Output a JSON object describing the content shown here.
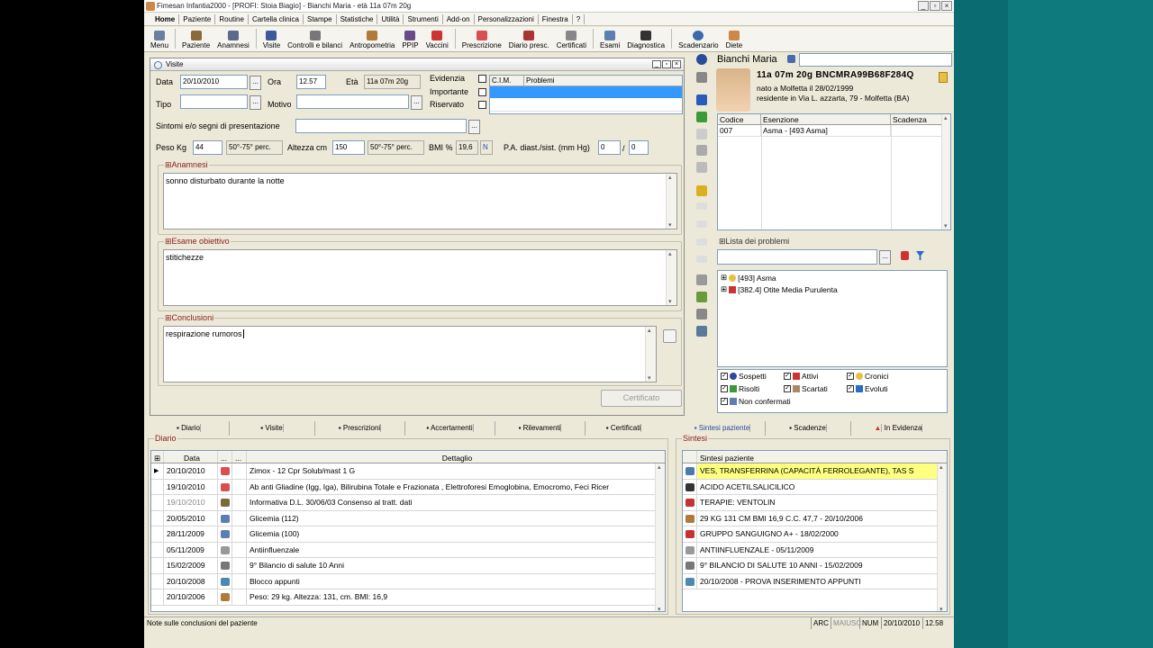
{
  "window": {
    "title": "Fimesan Infantia2000 - [PROFI: Stoia Biagio] - Bianchi Maria - età 11a 07m 20g"
  },
  "menu": [
    "Home",
    "Paziente",
    "Routine",
    "Cartella clinica",
    "Stampe",
    "Statistiche",
    "Utilità",
    "Strumenti",
    "Add-on",
    "Personalizzazioni",
    "Finestra",
    "?"
  ],
  "toolbar": [
    "Menu",
    "Paziente",
    "Anamnesi",
    "Visite",
    "Controlli e bilanci",
    "Antropometria",
    "PPIP",
    "Vaccini",
    "Prescrizione",
    "Diario presc.",
    "Certificati",
    "Esami",
    "Diagnostica",
    "Scadenzario",
    "Diete"
  ],
  "visite": {
    "title": "Visite",
    "data_label": "Data",
    "data": "20/10/2010",
    "ora_label": "Ora",
    "ora": "12.57",
    "eta_label": "Età",
    "eta": "11a 07m 20g",
    "tipo_label": "Tipo",
    "motivo_label": "Motivo",
    "evidenzia": "Evidenzia",
    "importante": "Importante",
    "riservato": "Riservato",
    "cim_header": "C.I.M.",
    "problemi_header": "Problemi",
    "sintomi_label": "Sintomi e/o segni di presentazione",
    "peso_label": "Peso Kg",
    "peso": "44",
    "peso_perc": "50°-75° perc.",
    "altezza_label": "Altezza cm",
    "altezza": "150",
    "altezza_perc": "50°-75° perc.",
    "bmi_label": "BMI %",
    "bmi": "19,6",
    "bmi_flag": "N",
    "pa_label": "P.A. diast./sist. (mm Hg)",
    "pa_diast": "0",
    "pa_sep": "/",
    "pa_sist": "0",
    "anamnesi_title": "Anamnesi",
    "anamnesi_text": "sonno disturbato durante la notte",
    "esame_title": "Esame obiettivo",
    "esame_text": "stitichezze",
    "conclusioni_title": "Conclusioni",
    "conclusioni_text": "respirazione rumoros",
    "certificato_btn": "Certificato"
  },
  "patient": {
    "name": "Bianchi Maria",
    "summary": "11a 07m 20g  BNCMRA99B68F284Q",
    "born": "nato a Molfetta il 28/02/1999",
    "address": "residente in Via L. azzarta, 79 - Molfetta (BA)",
    "exemptions_headers": [
      "Codice",
      "Esenzione",
      "Scadenza"
    ],
    "exemptions": [
      {
        "codice": "007",
        "esenzione": "Asma - [493 Asma]",
        "scadenza": ""
      }
    ]
  },
  "problemi": {
    "title": "Lista dei problemi",
    "items": [
      "[493] Asma",
      "[382.4] Otite Media Purulenta"
    ],
    "filters": [
      "Sospetti",
      "Attivi",
      "Cronici",
      "Risolti",
      "Scartati",
      "Evoluti",
      "Non confermati"
    ]
  },
  "tabs_left": [
    "Diario",
    "Visite",
    "Prescrizioni",
    "Accertamenti",
    "Rilevamenti",
    "Certificati"
  ],
  "tabs_right": [
    "Sintesi paziente",
    "Scadenze",
    "In Evidenza"
  ],
  "diario": {
    "title": "Diario",
    "headers": [
      "Data",
      "...",
      "...",
      "Dettaglio"
    ],
    "rows": [
      {
        "data": "20/10/2010",
        "dettaglio": "Zimox - 12 Cpr Solub/mast 1 G",
        "color": "#d94f4f"
      },
      {
        "data": "19/10/2010",
        "dettaglio": "Ab anti Gliadine (Igg, Iga), Bilirubina Totale e Frazionata , Elettroforesi Emoglobina, Emocromo, Feci Ricer",
        "color": "#d94f4f"
      },
      {
        "data": "19/10/2010",
        "dettaglio": "Informativa D.L. 30/06/03 Consenso al tratt. dati",
        "color": "#7a6a3a"
      },
      {
        "data": "20/05/2010",
        "dettaglio": "Glicemia (112)",
        "color": "#5a7fb0"
      },
      {
        "data": "28/11/2009",
        "dettaglio": "Glicemia (100)",
        "color": "#5a7fb0"
      },
      {
        "data": "05/11/2009",
        "dettaglio": "Antiinfluenzale",
        "color": "#999999"
      },
      {
        "data": "15/02/2009",
        "dettaglio": "9° Bilancio di salute 10 Anni",
        "color": "#777777"
      },
      {
        "data": "20/10/2008",
        "dettaglio": "Blocco appunti",
        "color": "#4a8ab0"
      },
      {
        "data": "20/10/2006",
        "dettaglio": "Peso: 29 kg. Altezza: 131, cm. BMI: 16,9",
        "color": "#b07a3a"
      }
    ]
  },
  "sintesi": {
    "title": "Sintesi",
    "header": "Sintesi paziente",
    "rows": [
      {
        "text": "VES, TRANSFERRINA (CAPACITÀ FERROLEGANTE), TAS S",
        "color": "#4a7ab0"
      },
      {
        "text": "ACIDO ACETILSALICILICO",
        "color": "#333333"
      },
      {
        "text": "TERAPIE: VENTOLIN",
        "color": "#c33333"
      },
      {
        "text": "29 KG 131 CM BMI 16,9 C.C. 47,7 - 20/10/2006",
        "color": "#b07a3a"
      },
      {
        "text": "GRUPPO SANGUIGNO A+ - 18/02/2000",
        "color": "#c33333"
      },
      {
        "text": "ANTIINFLUENZALE - 05/11/2009",
        "color": "#999999"
      },
      {
        "text": "9° BILANCIO DI SALUTE 10 ANNI - 15/02/2009",
        "color": "#777777"
      },
      {
        "text": "20/10/2008 - PROVA INSERIMENTO APPUNTI",
        "color": "#4a8ab0"
      }
    ]
  },
  "status": {
    "text": "Note sulle conclusioni del paziente",
    "arc": "ARC",
    "maiusc": "MAIUSC",
    "num": "NUM",
    "date": "20/10/2010",
    "time": "12.58"
  }
}
